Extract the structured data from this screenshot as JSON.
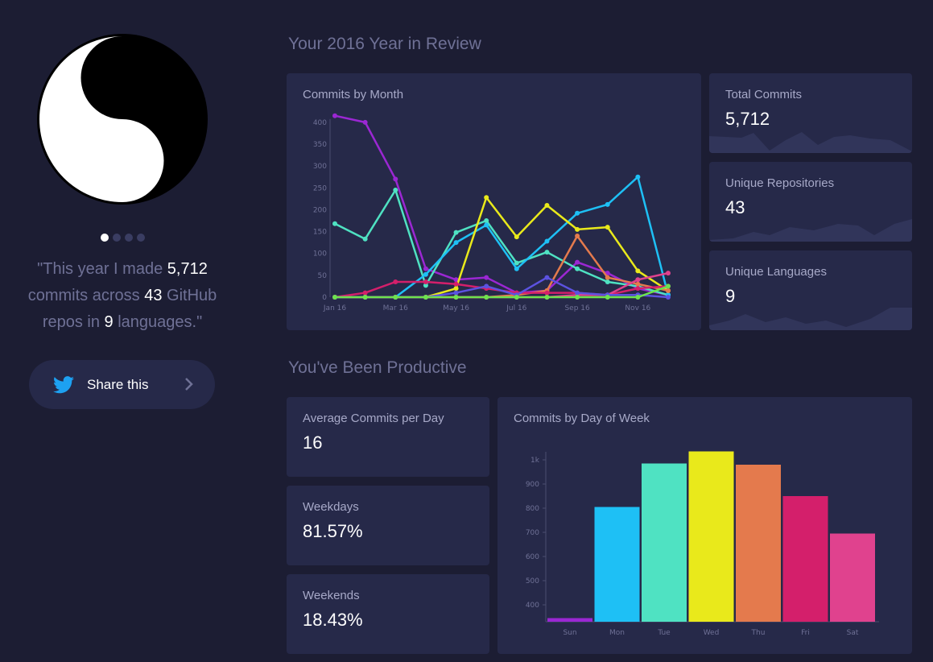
{
  "profile": {
    "quote_parts": [
      "\"This year I made ",
      "5,712",
      " commits across ",
      "43",
      " GitHub repos in ",
      "9",
      " languages.\""
    ],
    "slides": 4,
    "active_slide": 0,
    "share_label": "Share this"
  },
  "year_review": {
    "title": "Your 2016 Year in Review",
    "stats": [
      {
        "label": "Total Commits",
        "value": "5,712"
      },
      {
        "label": "Unique Repositories",
        "value": "43"
      },
      {
        "label": "Unique Languages",
        "value": "9"
      }
    ]
  },
  "productive": {
    "title": "You've Been Productive",
    "stats": [
      {
        "label": "Average Commits per Day",
        "value": "16"
      },
      {
        "label": "Weekdays",
        "value": "81.57%"
      },
      {
        "label": "Weekends",
        "value": "18.43%"
      }
    ]
  },
  "colors": {
    "bg": "#1c1d33",
    "card": "#262949",
    "muted": "#6f7196",
    "twitter": "#1da1f2"
  },
  "chart_data": [
    {
      "type": "line",
      "title": "Commits by Month",
      "x": [
        "Jan 16",
        "Feb 16",
        "Mar 16",
        "Apr 16",
        "May 16",
        "Jun 16",
        "Jul 16",
        "Aug 16",
        "Sep 16",
        "Oct 16",
        "Nov 16",
        "Dec 16"
      ],
      "x_tick_labels": [
        "Jan 16",
        "Mar 16",
        "May 16",
        "Jul 16",
        "Sep 16",
        "Nov 16"
      ],
      "y_ticks": [
        0,
        50,
        100,
        150,
        200,
        250,
        300,
        350,
        400
      ],
      "ylim": [
        0,
        420
      ],
      "grid": false,
      "series": [
        {
          "color": "#9b27d3",
          "values": [
            415,
            400,
            270,
            65,
            40,
            45,
            10,
            15,
            80,
            55,
            20,
            5
          ]
        },
        {
          "color": "#4fe2c2",
          "values": [
            168,
            133,
            245,
            27,
            148,
            175,
            78,
            103,
            65,
            35,
            25,
            5
          ]
        },
        {
          "color": "#1ec0f5",
          "values": [
            0,
            0,
            0,
            52,
            125,
            165,
            65,
            128,
            192,
            212,
            275,
            5
          ]
        },
        {
          "color": "#e9e91b",
          "values": [
            0,
            0,
            0,
            0,
            20,
            228,
            138,
            210,
            155,
            160,
            60,
            15
          ]
        },
        {
          "color": "#e47a4d",
          "values": [
            0,
            0,
            0,
            0,
            0,
            0,
            5,
            15,
            140,
            45,
            30,
            15
          ]
        },
        {
          "color": "#d41f6b",
          "values": [
            0,
            10,
            35,
            35,
            30,
            20,
            10,
            10,
            10,
            5,
            20,
            25
          ]
        },
        {
          "color": "#e0428e",
          "values": [
            0,
            0,
            0,
            0,
            0,
            0,
            0,
            0,
            5,
            5,
            40,
            55
          ]
        },
        {
          "color": "#5c52e0",
          "values": [
            0,
            0,
            0,
            0,
            10,
            25,
            5,
            45,
            10,
            5,
            5,
            0
          ]
        },
        {
          "color": "#6de24d",
          "values": [
            0,
            0,
            0,
            0,
            0,
            0,
            0,
            0,
            0,
            0,
            0,
            25
          ]
        }
      ]
    },
    {
      "type": "bar",
      "title": "Commits by Day of Week",
      "categories": [
        "Sun",
        "Mon",
        "Tue",
        "Wed",
        "Thu",
        "Fri",
        "Sat"
      ],
      "values": [
        345,
        805,
        985,
        1035,
        980,
        850,
        695
      ],
      "colors": [
        "#9b27d3",
        "#1ec0f5",
        "#4fe2c2",
        "#e9e91b",
        "#e47a4d",
        "#d41f6b",
        "#e0428e"
      ],
      "y_ticks": [
        400,
        500,
        600,
        700,
        800,
        900,
        1000
      ],
      "y_tick_labels": [
        "400",
        "500",
        "600",
        "700",
        "800",
        "900",
        "1k"
      ],
      "ylim": [
        330,
        1060
      ],
      "grid": false
    }
  ]
}
